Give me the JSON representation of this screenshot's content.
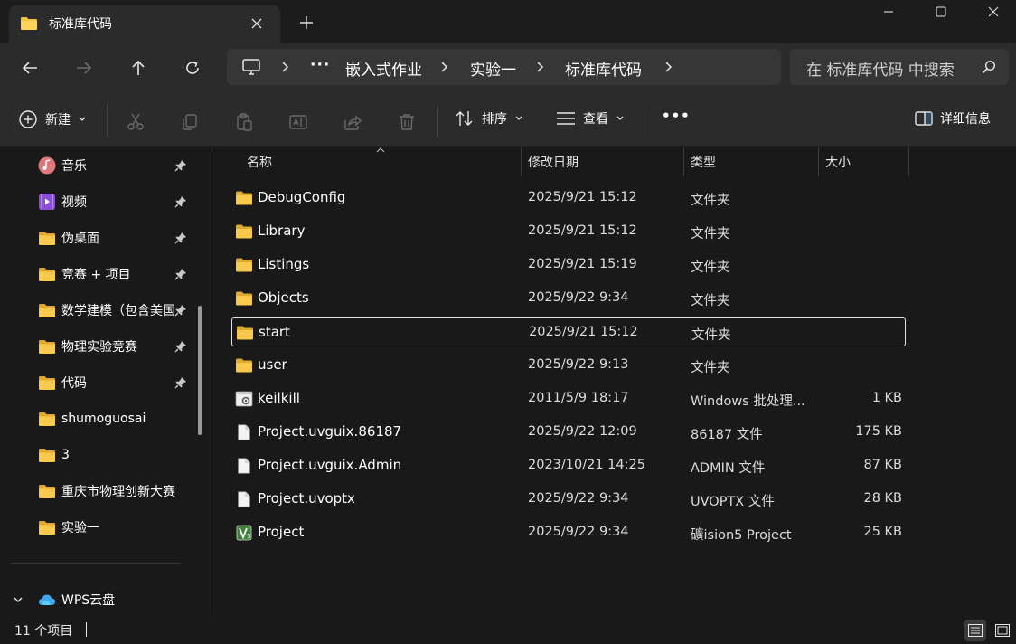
{
  "tab": {
    "title": "标准库代码"
  },
  "address": {
    "crumbs": [
      "嵌入式作业",
      "实验一",
      "标准库代码"
    ],
    "ellipsis": "···"
  },
  "search": {
    "placeholder": "在 标准库代码 中搜索"
  },
  "toolbar": {
    "new_label": "新建",
    "sort_label": "排序",
    "view_label": "查看",
    "more_label": "•••",
    "details_label": "详细信息"
  },
  "sidebar": {
    "items": [
      {
        "label": "音乐",
        "icon": "music-icon",
        "pinned": true
      },
      {
        "label": "视频",
        "icon": "video-icon",
        "pinned": true
      },
      {
        "label": "伪桌面",
        "icon": "folder-icon",
        "pinned": true
      },
      {
        "label": "竞赛 + 项目",
        "icon": "folder-icon",
        "pinned": true
      },
      {
        "label": "数学建模（包含美国",
        "icon": "folder-icon",
        "pinned": true
      },
      {
        "label": "物理实验竞赛",
        "icon": "folder-icon",
        "pinned": true
      },
      {
        "label": "代码",
        "icon": "folder-icon",
        "pinned": true
      },
      {
        "label": "shumoguosai",
        "icon": "folder-icon",
        "pinned": false
      },
      {
        "label": "3",
        "icon": "folder-icon",
        "pinned": false
      },
      {
        "label": "重庆市物理创新大赛",
        "icon": "folder-icon",
        "pinned": false
      },
      {
        "label": "实验一",
        "icon": "folder-icon",
        "pinned": false
      }
    ],
    "wps": {
      "label": "WPS云盘"
    }
  },
  "columns": {
    "name": "名称",
    "date": "修改日期",
    "type": "类型",
    "size": "大小"
  },
  "files": [
    {
      "name": "DebugConfig",
      "date": "2025/9/21 15:12",
      "type": "文件夹",
      "size": "",
      "icon": "folder"
    },
    {
      "name": "Library",
      "date": "2025/9/21 15:12",
      "type": "文件夹",
      "size": "",
      "icon": "folder"
    },
    {
      "name": "Listings",
      "date": "2025/9/21 15:19",
      "type": "文件夹",
      "size": "",
      "icon": "folder"
    },
    {
      "name": "Objects",
      "date": "2025/9/22 9:34",
      "type": "文件夹",
      "size": "",
      "icon": "folder"
    },
    {
      "name": "start",
      "date": "2025/9/21 15:12",
      "type": "文件夹",
      "size": "",
      "icon": "folder",
      "selected": true
    },
    {
      "name": "user",
      "date": "2025/9/22 9:13",
      "type": "文件夹",
      "size": "",
      "icon": "folder"
    },
    {
      "name": "keilkill",
      "date": "2011/5/9 18:17",
      "type": "Windows 批处理...",
      "size": "1 KB",
      "icon": "batch"
    },
    {
      "name": "Project.uvguix.86187",
      "date": "2025/9/22 12:09",
      "type": "86187 文件",
      "size": "175 KB",
      "icon": "file"
    },
    {
      "name": "Project.uvguix.Admin",
      "date": "2023/10/21 14:25",
      "type": "ADMIN 文件",
      "size": "87 KB",
      "icon": "file"
    },
    {
      "name": "Project.uvoptx",
      "date": "2025/9/22 9:34",
      "type": "UVOPTX 文件",
      "size": "28 KB",
      "icon": "file"
    },
    {
      "name": "Project",
      "date": "2025/9/22 9:34",
      "type": "礦ision5 Project",
      "size": "25 KB",
      "icon": "uvision"
    }
  ],
  "status": {
    "count": "11 个项目"
  },
  "colors": {
    "folder": "#f5c242",
    "background": "#191919",
    "toolbar": "#2b2b2b"
  }
}
